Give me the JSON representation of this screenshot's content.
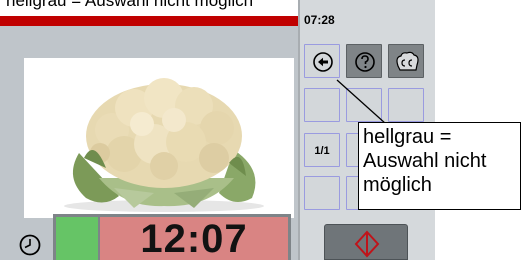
{
  "caption": {
    "text": "hellgrau = Auswahl nicht möglich"
  },
  "oven": {
    "time": "07:28",
    "timer": {
      "value": "12:07",
      "progress_fraction": 0.18
    },
    "buttons": {
      "back_icon": "arrow-left-circle-icon",
      "help_icon": "question-circle-icon",
      "cc_icon": "cc-chef-hat-icon",
      "one_one_label": "1/1",
      "start_icon": "start-diamond-icon"
    }
  },
  "callout": {
    "line1": "hellgrau =",
    "line2": "Auswahl nicht",
    "line3": "möglich"
  },
  "colors": {
    "red_bar": "#c00000",
    "timer_green": "#66c466",
    "timer_pink": "#d98483",
    "panel_grey": "#bfc5ca",
    "button_border": "#9a9be0",
    "active_button": "#7f8487"
  }
}
